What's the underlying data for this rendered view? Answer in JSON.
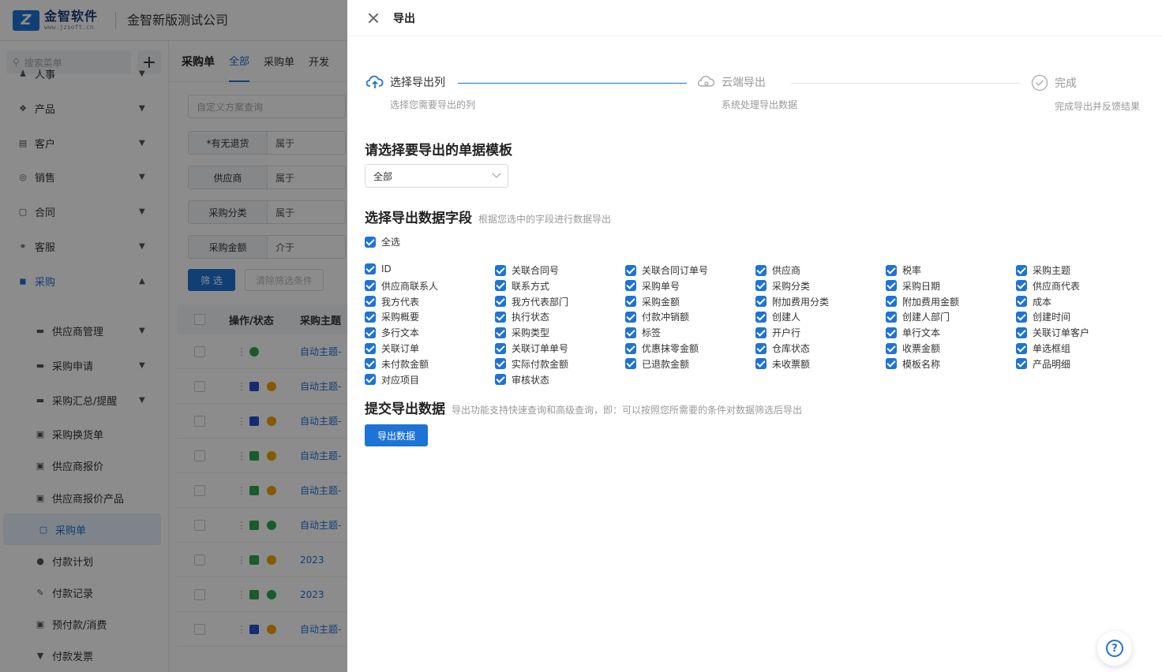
{
  "app": {
    "logo_mark": "Z",
    "logo_name": "金智软件",
    "logo_url": "www.jzsoft.cn",
    "company": "金智新版测试公司"
  },
  "sidebar": {
    "search_placeholder": "搜索菜单",
    "add_label": "+",
    "items": [
      {
        "label": "人事",
        "icon": "person-icon"
      },
      {
        "label": "产品",
        "icon": "cube-icon"
      },
      {
        "label": "客户",
        "icon": "contacts-icon"
      },
      {
        "label": "销售",
        "icon": "target-icon"
      },
      {
        "label": "合同",
        "icon": "document-icon"
      },
      {
        "label": "客服",
        "icon": "headset-icon"
      },
      {
        "label": "采购",
        "icon": "cart-icon"
      }
    ],
    "sub_items": [
      {
        "label": "供应商管理",
        "icon": "folder-icon",
        "expand": true
      },
      {
        "label": "采购申请",
        "icon": "folder-icon",
        "expand": true
      },
      {
        "label": "采购汇总/提醒",
        "icon": "folder-icon",
        "expand": true
      },
      {
        "label": "采购换货单",
        "icon": "exchange-icon",
        "expand": false
      },
      {
        "label": "供应商报价",
        "icon": "quote-icon",
        "expand": false
      },
      {
        "label": "供应商报价产品",
        "icon": "quote-icon",
        "expand": false
      },
      {
        "label": "采购单",
        "icon": "order-icon",
        "expand": false
      },
      {
        "label": "付款计划",
        "icon": "plan-icon",
        "expand": false
      },
      {
        "label": "付款记录",
        "icon": "record-icon",
        "expand": false
      },
      {
        "label": "预付款/消费",
        "icon": "prepay-icon",
        "expand": false
      },
      {
        "label": "付款发票",
        "icon": "invoice-icon",
        "expand": false
      }
    ]
  },
  "main": {
    "page_name": "采购单",
    "tabs": [
      "全部",
      "采购单",
      "开发"
    ],
    "scheme_placeholder": "自定义方案查询",
    "filters": [
      {
        "label": "*有无退货",
        "op": "属于"
      },
      {
        "label": "供应商",
        "op": "属于"
      },
      {
        "label": "采购分类",
        "op": "属于"
      },
      {
        "label": "采购金额",
        "op": "介于"
      }
    ],
    "filter_btn": "筛 选",
    "clear_btn": "清除筛选条件",
    "columns": [
      "操作/状态",
      "采购主题"
    ],
    "rows": [
      {
        "subject": "自动主题-",
        "s1": "",
        "s2": "#2fa84f"
      },
      {
        "subject": "自动主题-",
        "s1": "#2b4fd1",
        "s2": "#f0a500"
      },
      {
        "subject": "自动主题-",
        "s1": "#2b4fd1",
        "s2": "#f0a500"
      },
      {
        "subject": "自动主题-",
        "s1": "#2fa84f",
        "s2": "#f0a500"
      },
      {
        "subject": "自动主题-",
        "s1": "#2fa84f",
        "s2": "#f0a500"
      },
      {
        "subject": "自动主题-",
        "s1": "#2fa84f",
        "s2": "#2fa84f"
      },
      {
        "subject": "2023",
        "s1": "#2fa84f",
        "s2": "#f0a500"
      },
      {
        "subject": "2023",
        "s1": "#2fa84f",
        "s2": "#2fa84f"
      },
      {
        "subject": "自动主题-",
        "s1": "#2b4fd1",
        "s2": "#f0a500"
      }
    ]
  },
  "drawer": {
    "title": "导出",
    "steps": [
      {
        "name": "选择导出列",
        "desc": "选择您需要导出的列",
        "icon": "cloud-upload-icon"
      },
      {
        "name": "云端导出",
        "desc": "系统处理导出数据",
        "icon": "cloud-icon"
      },
      {
        "name": "完成",
        "desc": "完成导出并反馈结果",
        "icon": "check-circle-icon"
      }
    ],
    "template_title": "请选择要导出的单据模板",
    "template_value": "全部",
    "fields_title": "选择导出数据字段",
    "fields_hint": "根据您选中的字段进行数据导出",
    "select_all": "全选",
    "fields": [
      "ID",
      "关联合同号",
      "关联合同订单号",
      "供应商",
      "税率",
      "采购主题",
      "供应商联系人",
      "联系方式",
      "采购单号",
      "采购分类",
      "采购日期",
      "供应商代表",
      "我方代表",
      "我方代表部门",
      "采购金额",
      "附加费用分类",
      "附加费用金额",
      "成本",
      "采购概要",
      "执行状态",
      "付款冲销额",
      "创建人",
      "创建人部门",
      "创建时间",
      "多行文本",
      "采购类型",
      "标签",
      "开户行",
      "单行文本",
      "关联订单客户",
      "关联订单",
      "关联订单单号",
      "优惠抹零金额",
      "仓库状态",
      "收票金额",
      "单选框组",
      "未付款金额",
      "实际付款金额",
      "已退款金额",
      "未收票额",
      "模板名称",
      "产品明细",
      "对应项目",
      "审核状态"
    ],
    "submit_title": "提交导出数据",
    "submit_hint": "导出功能支持快速查询和高级查询，即：可以按照您所需要的条件对数据筛选后导出",
    "export_btn": "导出数据",
    "colors": {
      "accent": "#1e73d6",
      "success": "#2fa84f",
      "warning": "#f0a500"
    }
  }
}
